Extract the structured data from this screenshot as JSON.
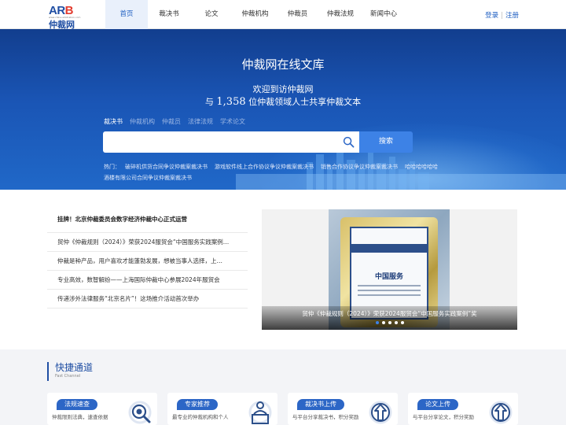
{
  "brand": {
    "logo_text_a": "AR",
    "logo_text_b": "B",
    "logo_tiny": "www.china-arbitration.com",
    "logo_cn": "仲裁网"
  },
  "nav": {
    "items": [
      {
        "label": "首页",
        "active": true
      },
      {
        "label": "裁决书"
      },
      {
        "label": "论文"
      },
      {
        "label": "仲裁机构"
      },
      {
        "label": "仲裁员"
      },
      {
        "label": "仲裁法规"
      },
      {
        "label": "新闻中心"
      }
    ],
    "login": "登录",
    "separator": "|",
    "register": "注册"
  },
  "hero": {
    "title": "仲裁网在线文库",
    "subtitle_line1": "欢迎到访仲裁网",
    "subtitle_pre": "与",
    "subtitle_count": "1,358",
    "subtitle_post": "位仲裁领域人士共享仲裁文本",
    "tabs": [
      "裁决书",
      "仲裁机构",
      "仲裁员",
      "法律法规",
      "学术论文"
    ],
    "search_placeholder": "",
    "search_button": "搜索",
    "hot_label": "热门：",
    "hot_items": [
      "破碎机供货合同争议仲裁案裁决书",
      "游戏软件线上合作协议争议仲裁案裁决书",
      "销售合作协议争议仲裁案裁决书",
      "哈哈哈哈哈哈",
      "酒楼有限公司合同争议仲裁案裁决书"
    ]
  },
  "news": {
    "items": [
      "挂牌！北京仲裁委员会数字经济仲裁中心正式运营",
      "贸仲《仲裁规则（2024）》荣获2024服贸会“中国服务实践案例…",
      "仲裁是种产品，用户喜欢才能蓬勃发展，想被当事人选择，上…",
      "专业高效，数智解纷——上海国际仲裁中心参展2024年服贸会",
      "传递涉外法律服务“北京名片”！这场推介活动首次举办"
    ]
  },
  "carousel": {
    "plaque_title": "中国服务",
    "caption": "贸仲《仲裁规则（2024）》荣获2024服贸会“中国服务实践案例”奖",
    "dots": 5,
    "active_index": 0
  },
  "quick": {
    "title": "快捷通道",
    "subtitle": "Fast Channel",
    "cards": [
      {
        "label": "法规速查",
        "desc": "仲裁限则法典，速查依据",
        "icon": "magnifier-target-icon"
      },
      {
        "label": "专家推荐",
        "desc": "最专业的仲裁机构和个人",
        "icon": "expert-podium-icon"
      },
      {
        "label": "裁决书上传",
        "desc": "与平台分享裁决书，积分奖励",
        "icon": "upload-arrow-icon"
      },
      {
        "label": "论文上传",
        "desc": "与平台分享论文，积分奖励",
        "icon": "upload-arrow-icon"
      }
    ]
  },
  "colors": {
    "brand_blue": "#1f4ea3",
    "accent": "#3d82e6",
    "logo_red": "#e23b2e"
  }
}
